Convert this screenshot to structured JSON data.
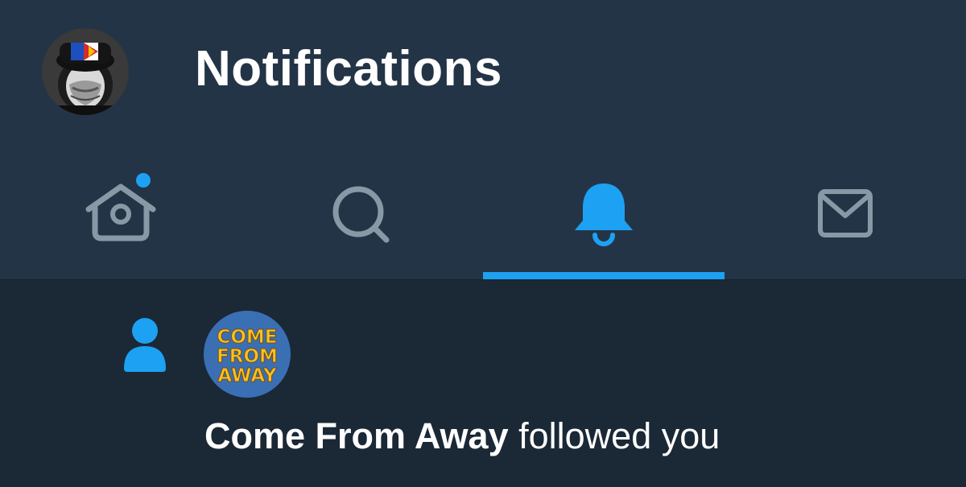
{
  "header": {
    "title": "Notifications"
  },
  "tabs": [
    {
      "name": "home",
      "icon": "home-icon",
      "active": false,
      "has_unread_dot": true
    },
    {
      "name": "search",
      "icon": "search-icon",
      "active": false,
      "has_unread_dot": false
    },
    {
      "name": "notifications",
      "icon": "bell-icon",
      "active": true,
      "has_unread_dot": false
    },
    {
      "name": "messages",
      "icon": "mail-icon",
      "active": false,
      "has_unread_dot": false
    }
  ],
  "notification": {
    "type_icon": "person-icon",
    "actor": "Come From Away",
    "action": "followed you",
    "avatar_text": [
      "COME",
      "FROM",
      "AWAY"
    ]
  },
  "colors": {
    "header_bg": "#243447",
    "body_bg": "#1b2836",
    "accent": "#1da1f2",
    "inactive_icon": "#8899a6",
    "text": "#ffffff"
  }
}
